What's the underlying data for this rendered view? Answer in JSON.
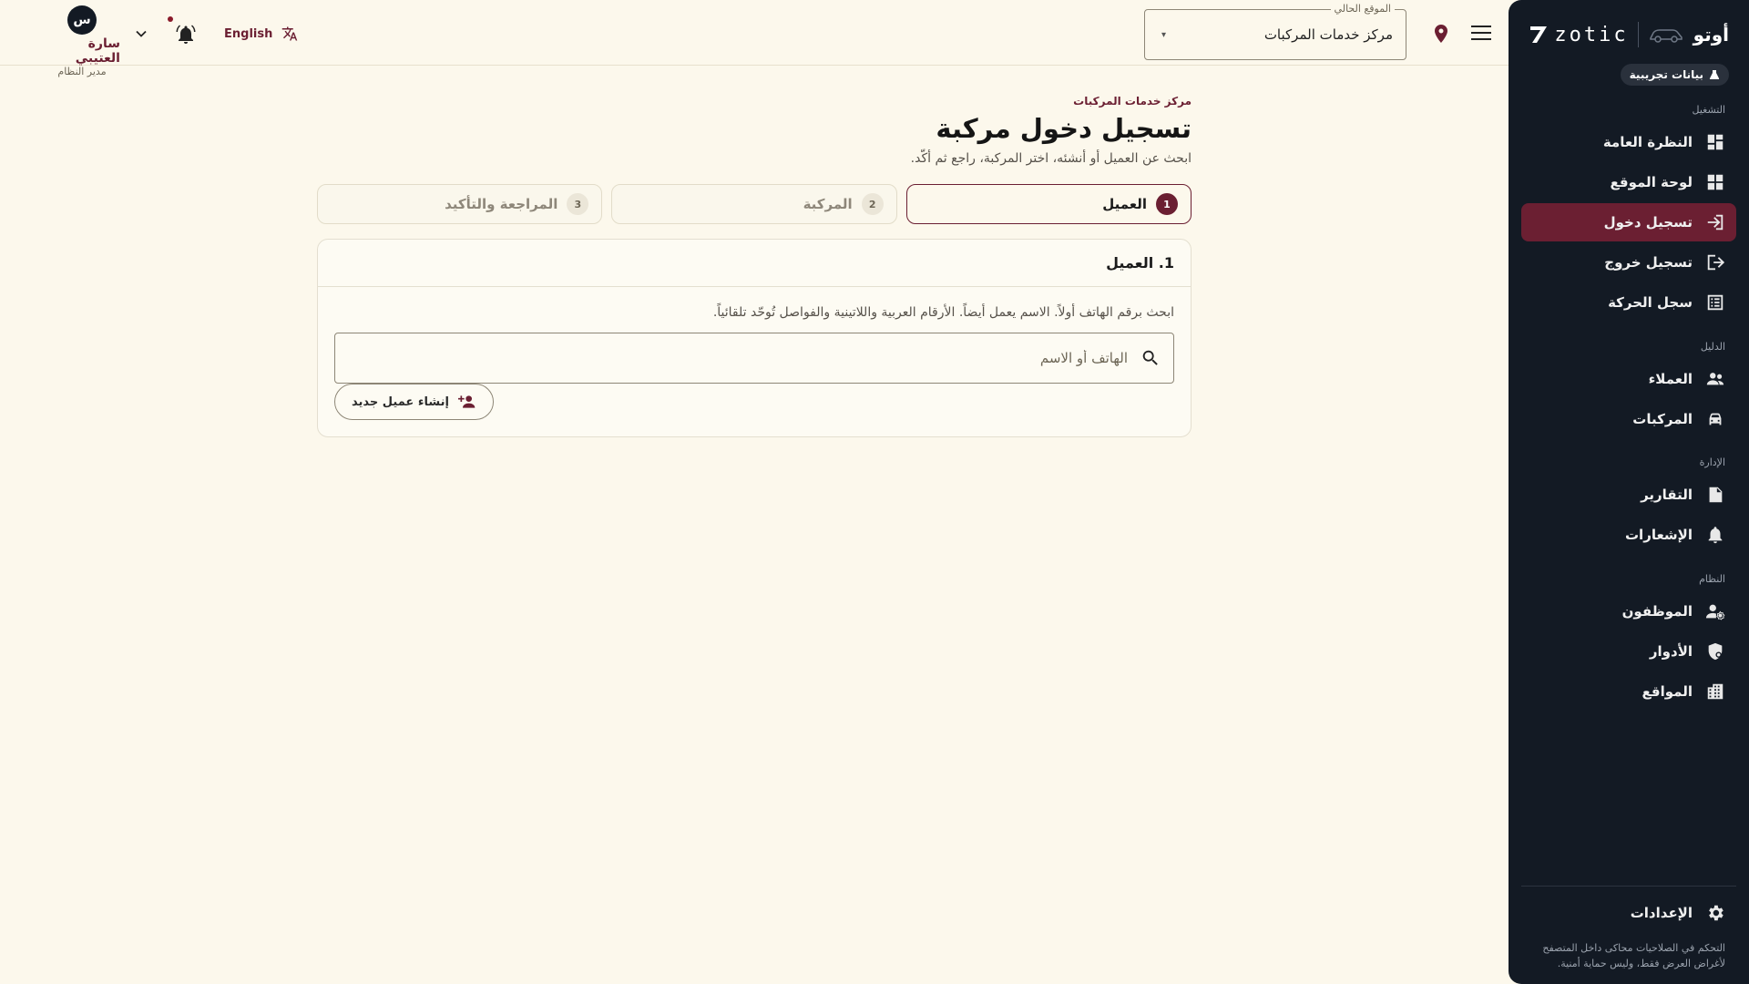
{
  "sidebar": {
    "brand_name": "أوتو",
    "brand_logo_text": "zotic",
    "demo_badge": "بيانات تجريبية",
    "sections": {
      "operation": "التشغيل",
      "directory": "الدليل",
      "management": "الإدارة",
      "system": "النظام"
    },
    "items": [
      {
        "label": "النظرة العامة",
        "icon": "dashboard-icon"
      },
      {
        "label": "لوحة الموقع",
        "icon": "site-board-icon"
      },
      {
        "label": "تسجيل دخول",
        "icon": "login-icon",
        "active": true
      },
      {
        "label": "تسجيل خروج",
        "icon": "logout-icon"
      },
      {
        "label": "سجل الحركة",
        "icon": "list-icon"
      },
      {
        "label": "العملاء",
        "icon": "people-icon"
      },
      {
        "label": "المركبات",
        "icon": "car-icon"
      },
      {
        "label": "التقارير",
        "icon": "report-icon"
      },
      {
        "label": "الإشعارات",
        "icon": "bell-icon"
      },
      {
        "label": "الموظفون",
        "icon": "staff-icon"
      },
      {
        "label": "الأدوار",
        "icon": "roles-shield-icon"
      },
      {
        "label": "المواقع",
        "icon": "building-icon"
      }
    ],
    "settings_label": "الإعدادات",
    "footer_note_line1": "التحكم في الصلاحيات محاكى داخل المتصفح",
    "footer_note_line2": "لأغراض العرض فقط، وليس حماية أمنية."
  },
  "header": {
    "location_label": "الموقع الحالي",
    "location_value": "مركز خدمات المركبات",
    "user_initial": "س",
    "user_name": "سارة العتيبي",
    "user_role": "مدير النظام",
    "language_label": "English"
  },
  "main": {
    "breadcrumb": "مركز خدمات المركبات",
    "title": "تسجيل دخول مركبة",
    "subtitle": "ابحث عن العميل أو أنشئه، اختر المركبة، راجع ثم أكّد.",
    "steps": [
      {
        "num": "1",
        "label": "العميل",
        "active": true
      },
      {
        "num": "2",
        "label": "المركبة",
        "active": false
      },
      {
        "num": "3",
        "label": "المراجعة والتأكيد",
        "active": false
      }
    ],
    "card_title": "1. العميل",
    "hint": "ابحث برقم الهاتف أولاً. الاسم يعمل أيضاً. الأرقام العربية واللاتينية والفواصل تُوحّد تلقائياً.",
    "search_placeholder": "الهاتف أو الاسم",
    "new_customer_label": "إنشاء عميل جديد"
  },
  "colors": {
    "accent": "#6b1f32",
    "sidebar_bg": "#131a24",
    "page_bg": "#fcf8ec"
  }
}
